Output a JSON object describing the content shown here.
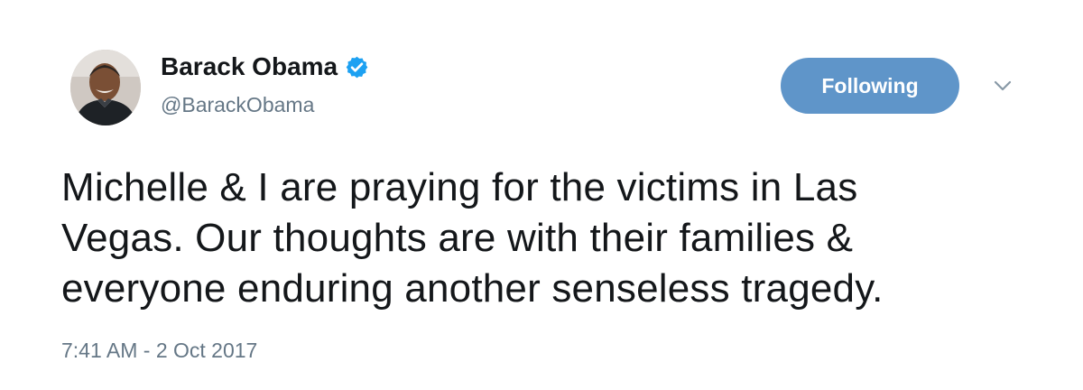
{
  "tweet": {
    "author": {
      "display_name": "Barack Obama",
      "screen_name": "@BarackObama",
      "verified": true,
      "avatar_icon": "profile-photo"
    },
    "follow_button_label": "Following",
    "menu_icon": "chevron-down-icon",
    "text": "Michelle & I are praying for the victims in Las\nVegas. Our thoughts are with their families &\neveryone enduring another senseless tragedy.",
    "timestamp": "7:41 AM - 2 Oct 2017"
  },
  "colors": {
    "button_bg": "#5f95c9",
    "verified_badge": "#1da1f2",
    "secondary_text": "#657786",
    "primary_text": "#14171a"
  }
}
